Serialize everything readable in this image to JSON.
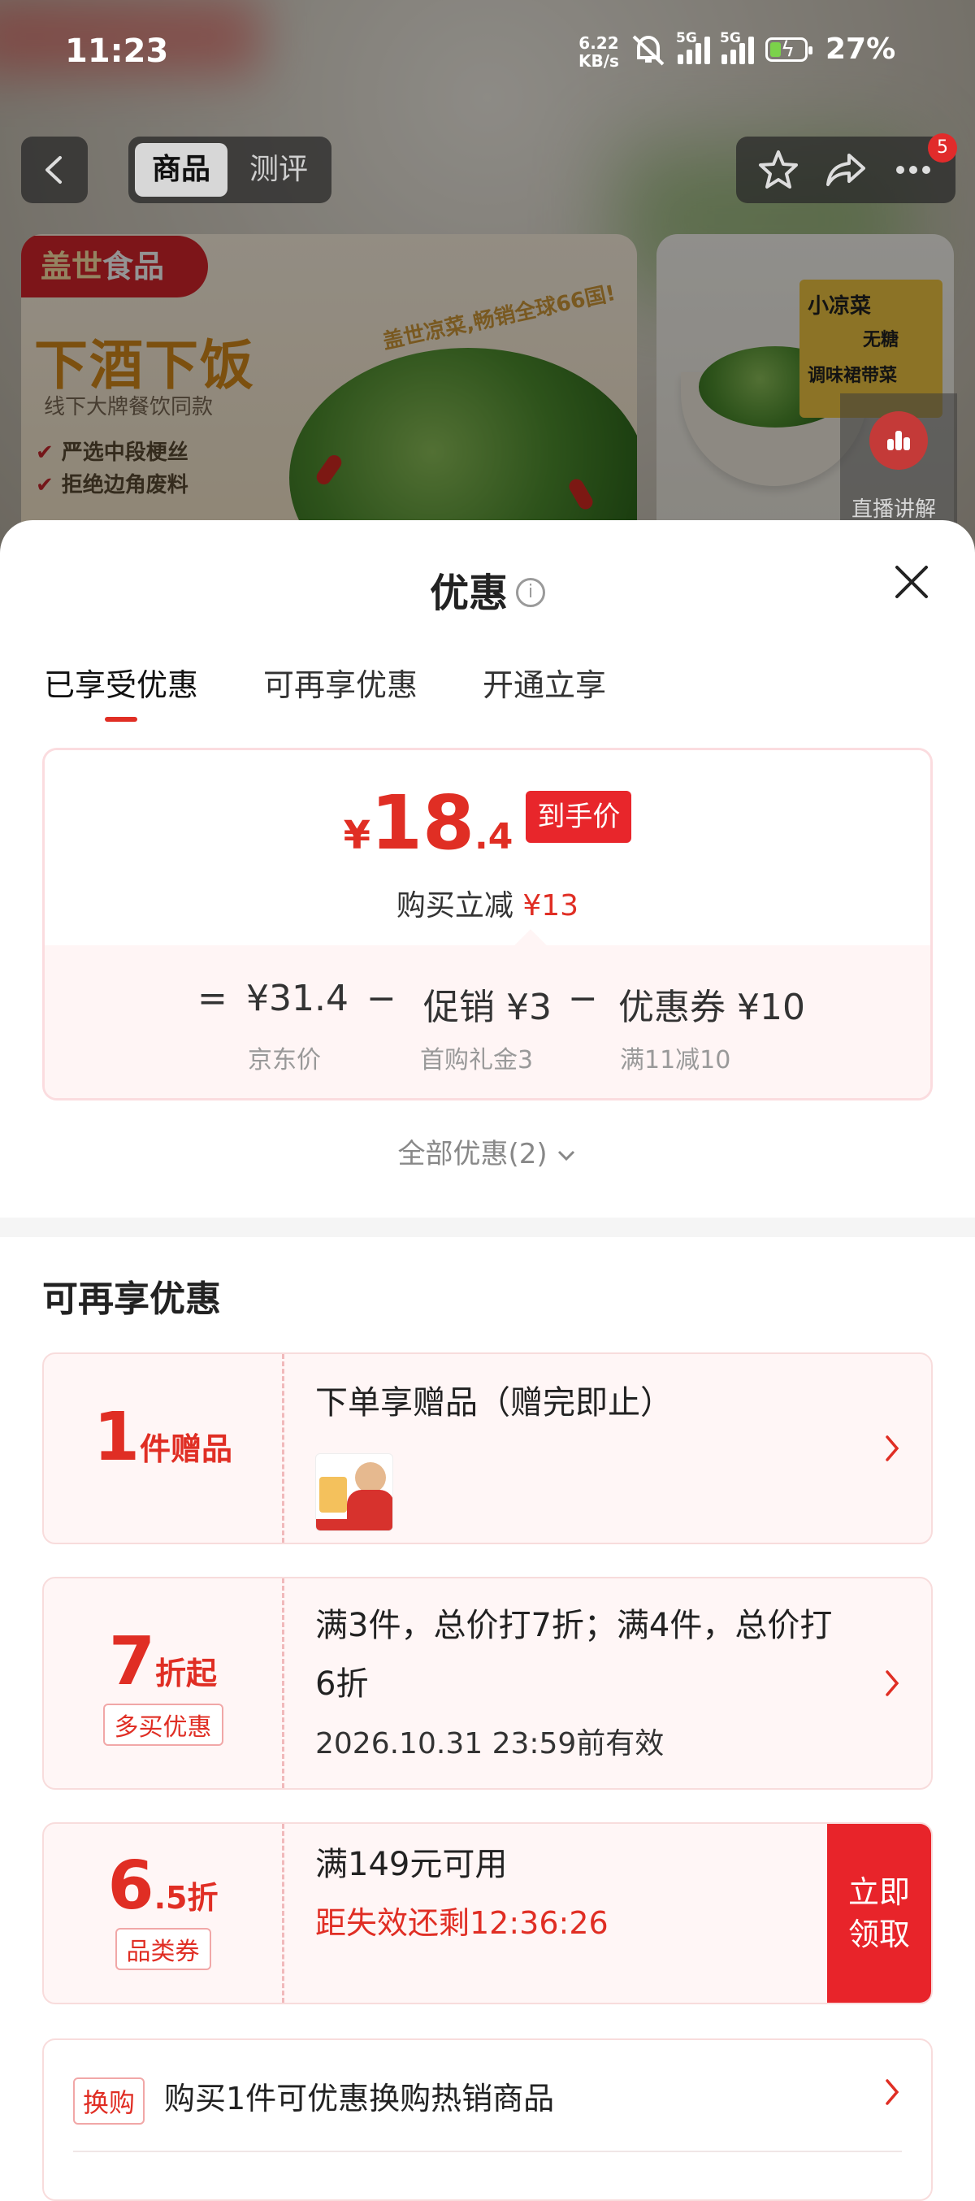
{
  "status_bar": {
    "time": "11:23",
    "net_speed_value": "6.22",
    "net_speed_unit": "KB/s",
    "sim1": "5G",
    "sim2": "5G",
    "battery": "27%"
  },
  "page_nav": {
    "tab_product": "商品",
    "tab_review": "测评",
    "more_badge": "5",
    "live_label": "直播讲解"
  },
  "hero": {
    "brand": "盖世",
    "brand_suffix": "食品",
    "slogan": "盖世凉菜,畅销全球66国!",
    "headline": "下酒下饭",
    "subline": "线下大牌餐饮同款",
    "bullet1": "严选中段梗丝",
    "bullet2": "拒绝边角废料",
    "pack_line1": "小凉菜",
    "pack_line2": "无糖",
    "pack_line3": "调味裙带菜"
  },
  "sheet": {
    "title": "优惠",
    "tabs": [
      "已享受优惠",
      "可再享优惠",
      "开通立享"
    ],
    "price": {
      "currency": "¥",
      "int": "18",
      "dec": ".4",
      "tag": "到手价",
      "save_label": "购买立减",
      "save_amount": "¥13"
    },
    "formula": {
      "eq": "=",
      "jd_price": "¥31.4",
      "jd_label": "京东价",
      "minus1": "−",
      "promo": "促销 ¥3",
      "promo_label": "首购礼金3",
      "minus2": "−",
      "coupon": "优惠券 ¥10",
      "coupon_label": "满11减10"
    },
    "all_discounts": "全部优惠(2)",
    "section_title": "可再享优惠",
    "offers": [
      {
        "big": "1",
        "small": "件赠品",
        "text": "下单享赠品（赠完即止）"
      },
      {
        "big": "7",
        "small": "折起",
        "tag": "多买优惠",
        "text": "满3件，总价打7折；满4件，总价打6折",
        "date": "2026.10.31 23:59前有效"
      },
      {
        "big": "6",
        "small": ".5折",
        "tag": "品类券",
        "text": "满149元可用",
        "countdown": "距失效还剩12:36:26",
        "button": "立即领取"
      }
    ],
    "swap": {
      "tag": "换购",
      "text": "购买1件可优惠换购热销商品"
    }
  },
  "colors": {
    "accent": "#e02e24",
    "light_pink": "#fff6f6"
  }
}
